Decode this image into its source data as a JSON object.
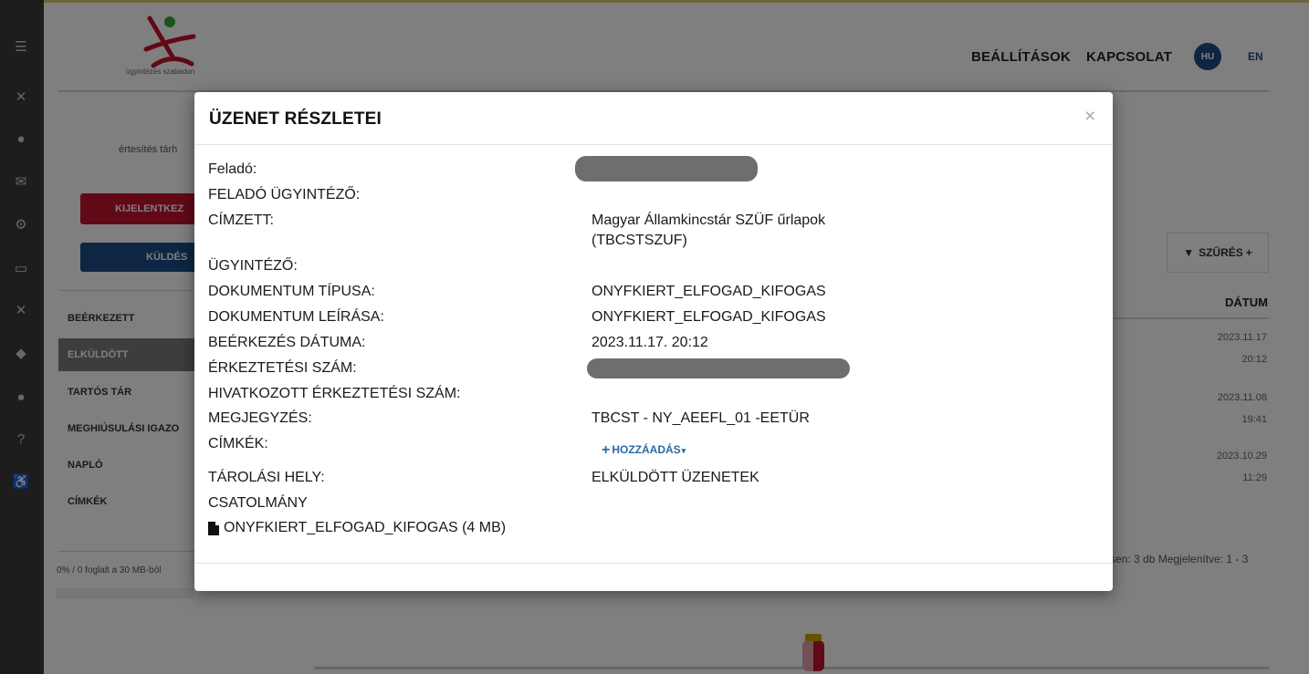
{
  "background": {
    "logo_text": "ügyintézés szabadon",
    "header_links": [
      "BEÁLLÍTÁSOK",
      "KAPCSOLAT"
    ],
    "lang_active": "HU",
    "lang_other": "EN",
    "notify_text": "értesítés tárh",
    "logout_button": "KIJELENTKEZ",
    "send_button": "KÜLDÉS",
    "sidebar_items": [
      "BEÉRKEZETT",
      "ELKÜLDÖTT",
      "TARTÓS TÁR",
      "MEGHIÚSULÁSI IGAZO",
      "NAPLÓ",
      "CÍMKÉK"
    ],
    "filter_label": "SZŰRÉS",
    "date_header": "DÁTUM",
    "dates": [
      [
        "2023.11.17",
        "20:12"
      ],
      [
        "2023.11.08",
        "19:41"
      ],
      [
        "2023.10.29",
        "11:29"
      ]
    ],
    "storage_text": "0% / 0 foglalt a 30 MB-ból",
    "pagination_text": "sen: 3 db   Megjelenítve: 1 - 3"
  },
  "modal": {
    "title": "ÜZENET RÉSZLETEI",
    "close_symbol": "×",
    "rows": {
      "felado_label": "Feladó:",
      "felado_ugyintezo_label": "FELADÓ ÜGYINTÉZŐ:",
      "cimzett_label": "CÍMZETT:",
      "cimzett_value_line1": "Magyar Államkincstár SZÜF űrlapok",
      "cimzett_value_line2": "(TBCSTSZUF)",
      "ugyintezo_label": "ÜGYINTÉZŐ:",
      "dok_tipusa_label": "DOKUMENTUM TÍPUSA:",
      "dok_tipusa_value": "ONYFKIERT_ELFOGAD_KIFOGAS",
      "dok_leirasa_label": "DOKUMENTUM LEÍRÁSA:",
      "dok_leirasa_value": "ONYFKIERT_ELFOGAD_KIFOGAS",
      "beerkezes_label": "BEÉRKEZÉS DÁTUMA:",
      "beerkezes_value": "2023.11.17. 20:12",
      "erkeztetesi_label": "ÉRKEZTETÉSI SZÁM:",
      "hiv_erkeztetesi_label": "HIVATKOZOTT ÉRKEZTETÉSI SZÁM:",
      "megjegyzes_label": "MEGJEGYZÉS:",
      "megjegyzes_value": "TBCST - NY_AEEFL_01 -EETÜR",
      "cimkek_label": "CÍMKÉK:",
      "hozzaadas_label": "HOZZÁADÁS",
      "tarolasi_label": "TÁROLÁSI HELY:",
      "tarolasi_value": "ELKÜLDÖTT ÜZENETEK",
      "csatolmany_label": "CSATOLMÁNY",
      "attachment_name": "ONYFKIERT_ELFOGAD_KIFOGAS (4 MB)"
    }
  }
}
